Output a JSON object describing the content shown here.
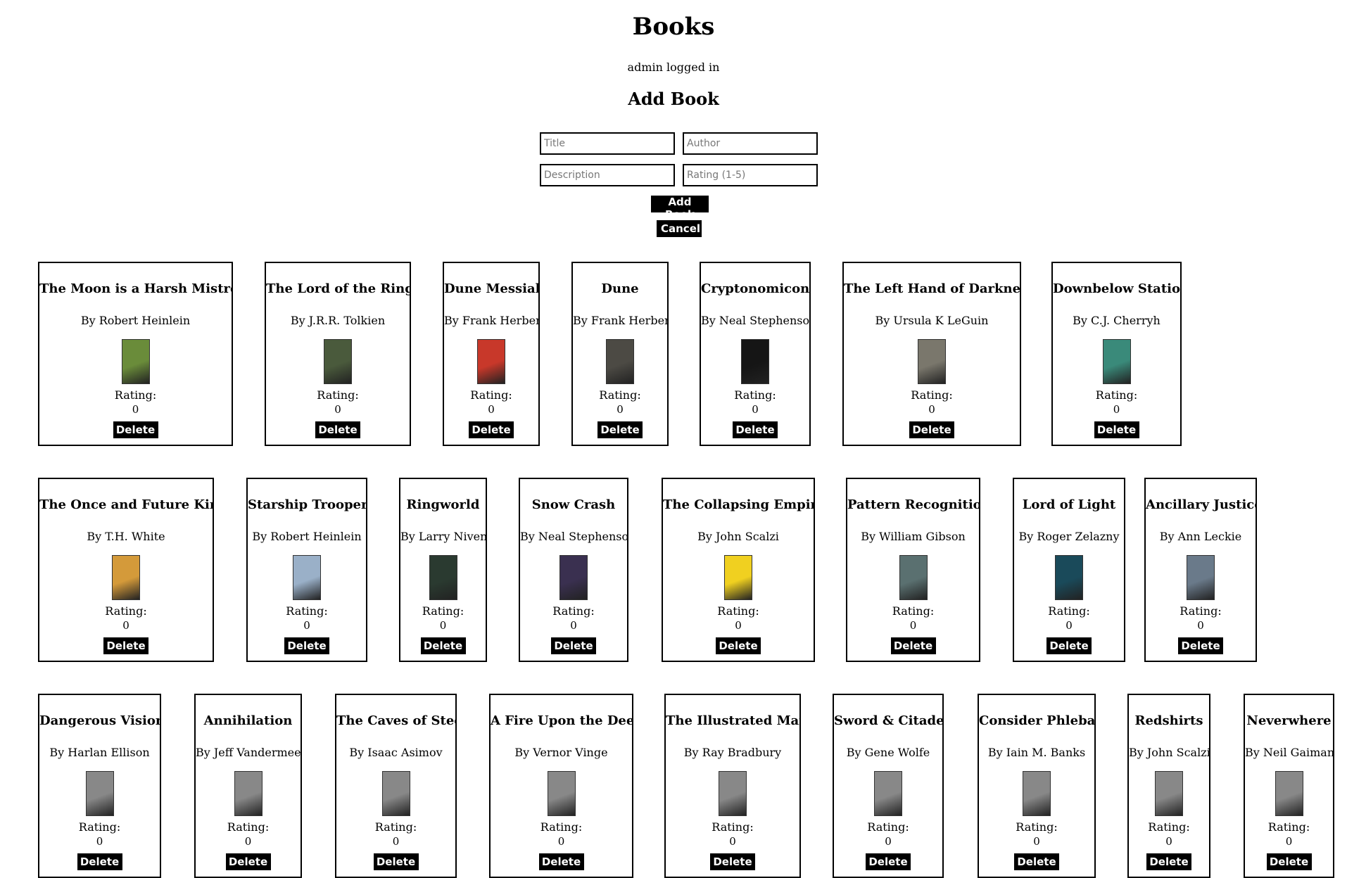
{
  "header": {
    "title": "Books",
    "status": "admin logged in"
  },
  "form": {
    "heading": "Add Book",
    "title_placeholder": "Title",
    "author_placeholder": "Author",
    "description_placeholder": "Description",
    "rating_placeholder": "Rating (1-5)",
    "add_label": "Add Book",
    "cancel_label": "Cancel"
  },
  "labels": {
    "rating": "Rating:",
    "delete": "Delete"
  },
  "books": [
    {
      "title": "The Moon is a Harsh Mistress",
      "author": "By Robert Heinlein",
      "rating": "0",
      "cover_color": "#6a8c3a"
    },
    {
      "title": "The Lord of the Rings",
      "author": "By J.R.R. Tolkien",
      "rating": "0",
      "cover_color": "#4a5a3c"
    },
    {
      "title": "Dune Messiah",
      "author": "By Frank Herbert",
      "rating": "0",
      "cover_color": "#c8382a"
    },
    {
      "title": "Dune",
      "author": "By Frank Herbert",
      "rating": "0",
      "cover_color": "#4c4a44"
    },
    {
      "title": "Cryptonomicon",
      "author": "By Neal Stephenson",
      "rating": "0",
      "cover_color": "#151515"
    },
    {
      "title": "The Left Hand of Darkness",
      "author": "By Ursula K LeGuin",
      "rating": "0",
      "cover_color": "#7a776c"
    },
    {
      "title": "Downbelow Station",
      "author": "By C.J. Cherryh",
      "rating": "0",
      "cover_color": "#3a8a7a"
    },
    {
      "title": "The Once and Future King",
      "author": "By T.H. White",
      "rating": "0",
      "cover_color": "#d49a3a"
    },
    {
      "title": "Starship Troopers",
      "author": "By Robert Heinlein",
      "rating": "0",
      "cover_color": "#9ab0c8"
    },
    {
      "title": "Ringworld",
      "author": "By Larry Niven",
      "rating": "0",
      "cover_color": "#2a3a30"
    },
    {
      "title": "Snow Crash",
      "author": "By Neal Stephenson",
      "rating": "0",
      "cover_color": "#3a3050"
    },
    {
      "title": "The Collapsing Empire",
      "author": "By John Scalzi",
      "rating": "0",
      "cover_color": "#f0d020"
    },
    {
      "title": "Pattern Recognition",
      "author": "By William Gibson",
      "rating": "0",
      "cover_color": "#5a7070"
    },
    {
      "title": "Lord of Light",
      "author": "By Roger Zelazny",
      "rating": "0",
      "cover_color": "#1a4a5a"
    },
    {
      "title": "Ancillary Justice",
      "author": "By Ann Leckie",
      "rating": "0",
      "cover_color": "#6a7a8a"
    },
    {
      "title": "Dangerous Visions",
      "author": "By Harlan Ellison",
      "rating": "0",
      "cover_color": "#888888"
    },
    {
      "title": "Annihilation",
      "author": "By Jeff Vandermeer",
      "rating": "0",
      "cover_color": "#888888"
    },
    {
      "title": "The Caves of Steel",
      "author": "By Isaac Asimov",
      "rating": "0",
      "cover_color": "#888888"
    },
    {
      "title": "A Fire Upon the Deep",
      "author": "By Vernor Vinge",
      "rating": "0",
      "cover_color": "#888888"
    },
    {
      "title": "The Illustrated Man",
      "author": "By Ray Bradbury",
      "rating": "0",
      "cover_color": "#888888"
    },
    {
      "title": "Sword & Citadel",
      "author": "By Gene Wolfe",
      "rating": "0",
      "cover_color": "#888888"
    },
    {
      "title": "Consider Phlebas",
      "author": "By Iain M. Banks",
      "rating": "0",
      "cover_color": "#888888"
    },
    {
      "title": "Redshirts",
      "author": "By John Scalzi",
      "rating": "0",
      "cover_color": "#888888"
    },
    {
      "title": "Neverwhere",
      "author": "By Neil Gaiman",
      "rating": "0",
      "cover_color": "#888888"
    }
  ]
}
